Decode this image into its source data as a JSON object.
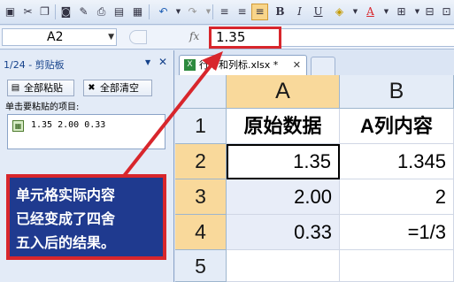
{
  "toolbar": {
    "buttons": [
      "save-icon",
      "cut-icon",
      "copy-icon",
      "format-painter-icon",
      "print-icon",
      "print-preview-icon",
      "undo-icon",
      "redo-icon",
      "align-left-icon",
      "align-center-icon",
      "align-right-icon",
      "bold-icon",
      "italic-icon",
      "underline-icon",
      "fill-color-icon",
      "font-color-icon",
      "borders-icon",
      "merge-icon"
    ],
    "bold_label": "B",
    "italic_label": "I",
    "underline_label": "U",
    "font_color_label": "A"
  },
  "formula_bar": {
    "name_box": "A2",
    "fx_label": "fx",
    "value": "1.35"
  },
  "clipboard": {
    "title": "1/24 - 剪贴板",
    "paste_all_label": "全部粘贴",
    "clear_all_label": "全部清空",
    "hint": "单击要粘贴的项目:",
    "items": [
      {
        "text": "1.35 2.00 0.33"
      }
    ]
  },
  "document_tab": {
    "label": "行号和列标.xlsx *"
  },
  "sheet": {
    "columns": [
      "A",
      "B"
    ],
    "rows": [
      "1",
      "2",
      "3",
      "4",
      "5"
    ],
    "cells": [
      [
        "原始数据",
        "A列内容"
      ],
      [
        "1.35",
        "1.345"
      ],
      [
        "2.00",
        "2"
      ],
      [
        "0.33",
        "=1/3"
      ],
      [
        "",
        ""
      ]
    ],
    "active_cell": "A2"
  },
  "callout": {
    "lines": [
      "单元格实际内容",
      "已经变成了四舍",
      "五入后的结果。"
    ]
  },
  "colors": {
    "annotation_red": "#d8262c",
    "callout_bg": "#1f3a8f",
    "selected_header": "#f9d99b"
  }
}
